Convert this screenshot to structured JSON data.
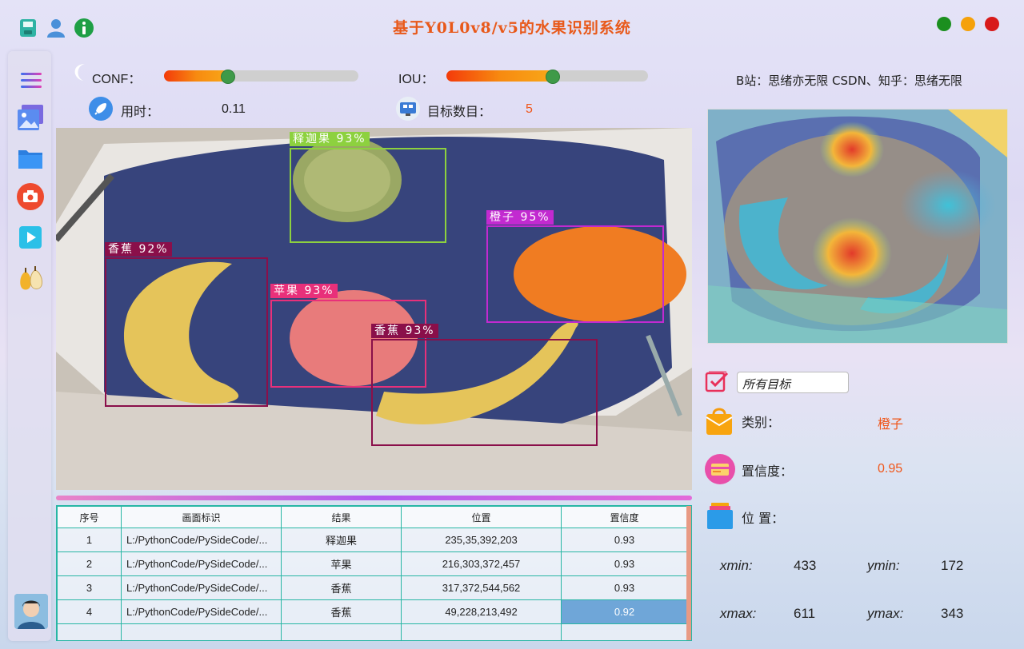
{
  "app": {
    "title": "基于Y0L0v8/v5的水果识别系统"
  },
  "header": {
    "credit": "B站：思绪亦无限  CSDN、知乎：思绪无限"
  },
  "top_icons": [
    "save-icon",
    "user-icon",
    "info-icon"
  ],
  "window_controls": {
    "colors": [
      "#1b8f1f",
      "#f5a10a",
      "#d81a1a"
    ]
  },
  "controls": {
    "conf": {
      "label": "CONF：",
      "value": 0.3
    },
    "iou": {
      "label": "IOU：",
      "value": 0.5
    },
    "time": {
      "label": "用时：",
      "value": "0.11"
    },
    "count": {
      "label": "目标数目：",
      "value": "5"
    }
  },
  "sidebar": {
    "items": [
      "menu-icon",
      "image-icon",
      "folder-icon",
      "camera-icon",
      "video-icon",
      "fruit-icon"
    ]
  },
  "detections": [
    {
      "label": "释迦果  93%",
      "color": "#8dd13f"
    },
    {
      "label": "橙子  95%",
      "color": "#c22ad0"
    },
    {
      "label": "香蕉  92%",
      "color": "#8a0f4a"
    },
    {
      "label": "苹果  93%",
      "color": "#e8307a"
    },
    {
      "label": "香蕉  93%",
      "color": "#8a0f4a"
    }
  ],
  "table": {
    "headers": [
      "序号",
      "画面标识",
      "结果",
      "位置",
      "置信度"
    ],
    "rows": [
      [
        "1",
        "L:/PythonCode/PySideCode/...",
        "释迦果",
        "235,35,392,203",
        "0.93"
      ],
      [
        "2",
        "L:/PythonCode/PySideCode/...",
        "苹果",
        "216,303,372,457",
        "0.93"
      ],
      [
        "3",
        "L:/PythonCode/PySideCode/...",
        "香蕉",
        "317,372,544,562",
        "0.93"
      ],
      [
        "4",
        "L:/PythonCode/PySideCode/...",
        "香蕉",
        "49,228,213,492",
        "0.92"
      ],
      [
        "",
        "",
        "",
        "",
        ""
      ]
    ]
  },
  "panel": {
    "target_select": "所有目标",
    "class_label": "类别：",
    "class_value": "橙子",
    "conf_label": "置信度：",
    "conf_value": "0.95",
    "pos_label": "位  置：",
    "xmin_label": "xmin:",
    "xmin": "433",
    "ymin_label": "ymin:",
    "ymin": "172",
    "xmax_label": "xmax:",
    "xmax": "611",
    "ymax_label": "ymax:",
    "ymax": "343"
  }
}
